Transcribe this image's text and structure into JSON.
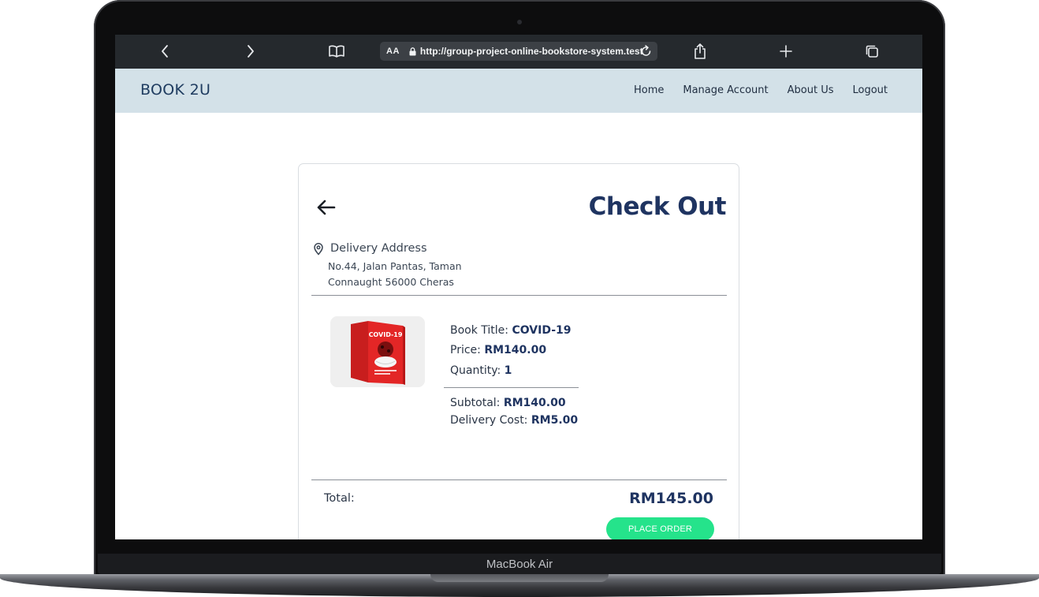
{
  "device": {
    "model_label": "MacBook Air"
  },
  "browser": {
    "reader_label": "AA",
    "url": "http://group-project-online-bookstore-system.test"
  },
  "site": {
    "brand": "BOOK 2U",
    "nav": [
      "Home",
      "Manage Account",
      "About Us",
      "Logout"
    ]
  },
  "checkout": {
    "title": "Check Out",
    "address_label": "Delivery Address",
    "address_lines": [
      "No.44, Jalan Pantas, Taman",
      "Connaught 56000 Cheras"
    ],
    "book_title_label": "Book Title:",
    "book_title": "COVID-19",
    "price_label": "Price:",
    "price": "RM140.00",
    "quantity_label": "Quantity:",
    "quantity": "1",
    "subtotal_label": "Subtotal:",
    "subtotal": "RM140.00",
    "delivery_label": "Delivery Cost:",
    "delivery": "RM5.00",
    "total_label": "Total:",
    "total": "RM145.00",
    "place_order_label": "PLACE ORDER",
    "cover_title": "COVID-19"
  },
  "colors": {
    "nav_bg": "#d3e1e8",
    "accent_navy": "#1f3461",
    "place_order_green": "#25e38b",
    "browser_toolbar": "#25292d"
  }
}
